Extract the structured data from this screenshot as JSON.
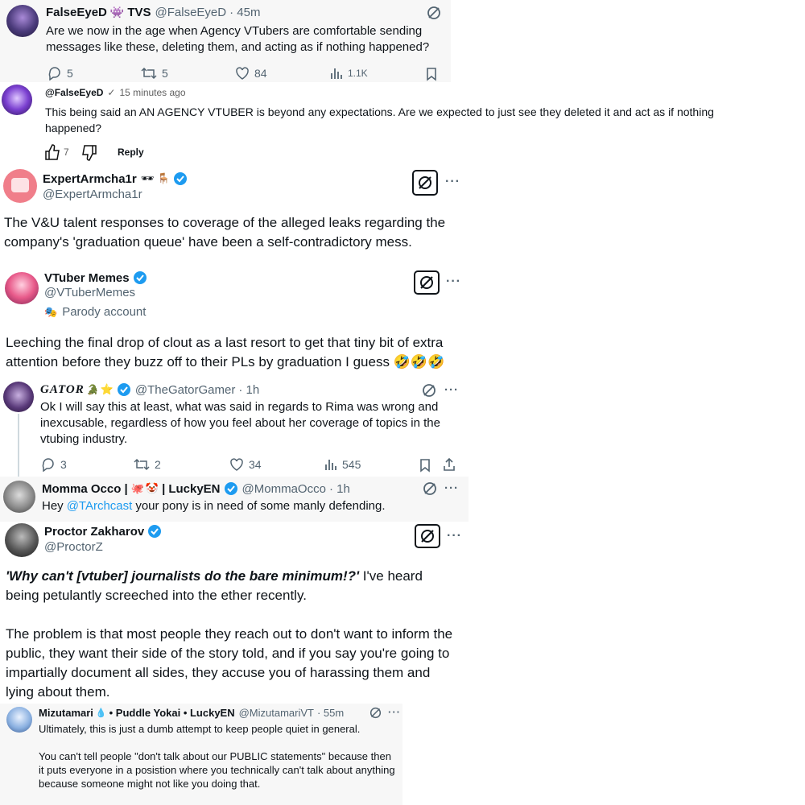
{
  "t1": {
    "name": "FalseEyeD",
    "name_suffix": "TVS",
    "handle": "@FalseEyeD",
    "time": "· 45m",
    "text": "Are we now in the age when Agency VTubers are comfortable sending messages like these, deleting them, and acting as if nothing happened?",
    "replies": "5",
    "reposts": "5",
    "likes": "84",
    "views": "1.1K"
  },
  "yt": {
    "handle": "@FalseEyeD",
    "check": "✓",
    "time": "15 minutes ago",
    "text": "This being said an AN AGENCY VTUBER is beyond any expectations. Are we expected to just see they deleted it and act as if nothing happened?",
    "likes": "7",
    "reply_label": "Reply"
  },
  "t2": {
    "name": "ExpertArmcha1r",
    "handle": "@ExpertArmcha1r",
    "text": "The V&U talent responses to coverage of the alleged leaks regarding the company's 'graduation queue' have been a self-contradictory mess."
  },
  "t3": {
    "name": "VTuber Memes",
    "handle": "@VTuberMemes",
    "parody_label": "Parody account",
    "text": "Leeching the final drop of clout as a last resort to get that tiny bit of extra attention before they buzz off to their PLs by graduation I guess 🤣🤣🤣"
  },
  "t4": {
    "name": "GATOR",
    "handle": "@TheGatorGamer",
    "time": "· 1h",
    "text": "Ok I will say this at least, what was said in regards to Rima was wrong and inexcusable, regardless of how you feel about her coverage of topics in the vtubing industry.",
    "replies": "3",
    "reposts": "2",
    "likes": "34",
    "views": "545"
  },
  "t5": {
    "name": "Momma Occo |",
    "name_mid": "|",
    "name_end": "LuckyEN",
    "handle": "@MommaOcco",
    "time": "· 1h",
    "text_pre": "Hey",
    "mention": "@TArchcast",
    "text_post": "your pony is in need of some manly defending."
  },
  "t6": {
    "name": "Proctor Zakharov",
    "handle": "@ProctorZ",
    "quote": "'Why can't [vtuber] journalists do the bare minimum!?'",
    "text1": "I've heard being petulantly screeched into the ether recently.",
    "text2": "The problem is that most people they reach out to don't want to inform the public, they want their side of the story told, and if you say you're going to impartially document all sides, they accuse you of harassing them and lying about them."
  },
  "t7": {
    "name": "Mizutamari",
    "name_rest": "• Puddle Yokai • LuckyEN",
    "handle": "@MizutamariVT",
    "time": "· 55m",
    "text1": "Ultimately, this is just a dumb attempt to keep people quiet in general.",
    "text2": "You can't tell people \"don't talk about our PUBLIC statements\" because then it puts everyone in a posistion where you technically can't talk about anything because someone might not like you doing that."
  },
  "colors": {
    "verified": "#1d9bf0",
    "secondary_text": "#536471",
    "link": "#1d9bf0",
    "card_gray": "#f7f7f7"
  }
}
